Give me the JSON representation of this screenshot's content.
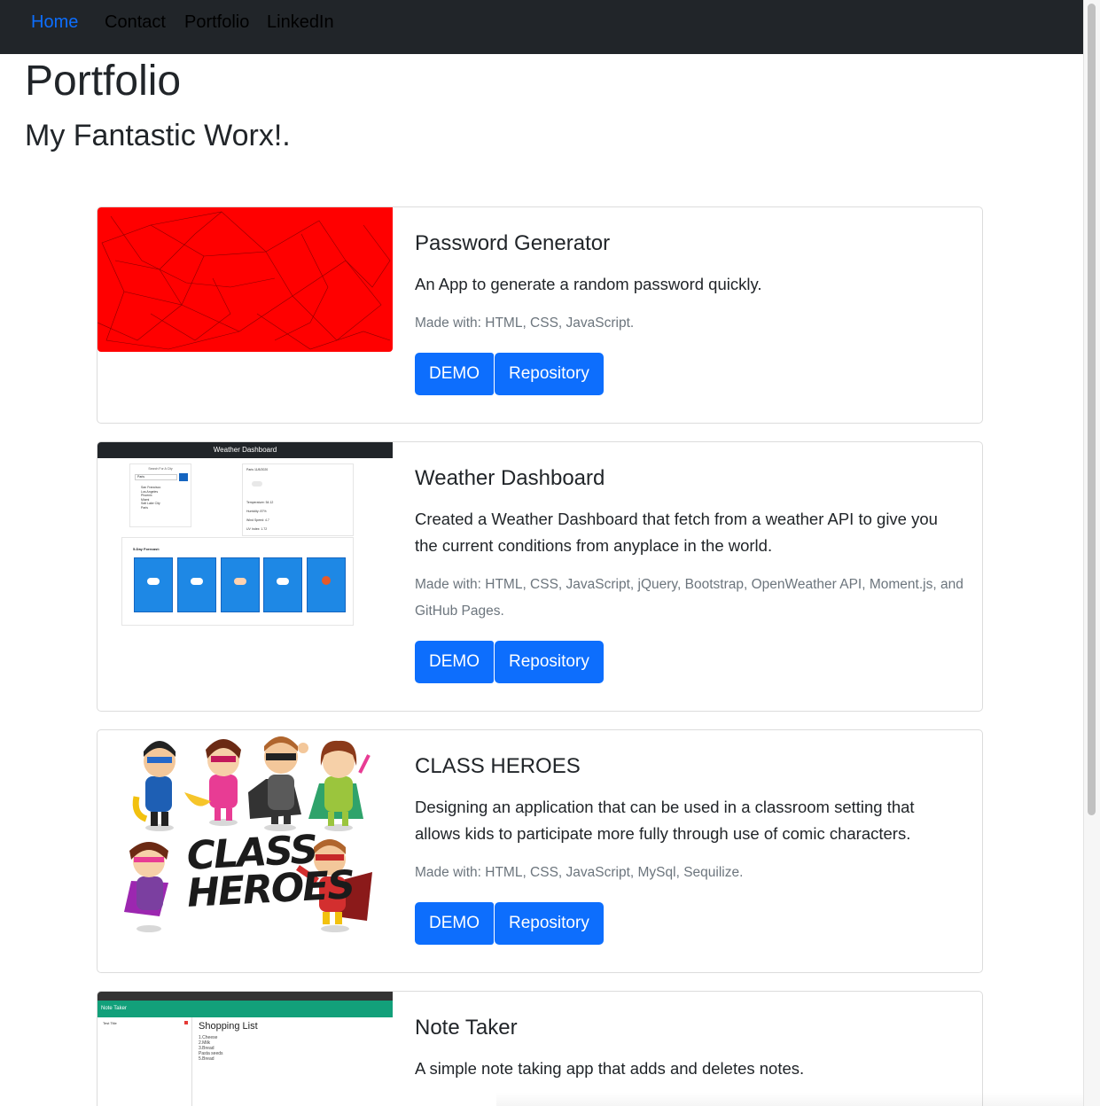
{
  "nav": {
    "items": [
      {
        "label": "Home",
        "active": true
      },
      {
        "label": "Contact",
        "active": false
      },
      {
        "label": "Portfolio",
        "active": false
      },
      {
        "label": "LinkedIn",
        "active": false
      }
    ]
  },
  "header": {
    "title": "Portfolio",
    "subtitle": "My Fantastic Worx!."
  },
  "projects": [
    {
      "title": "Password Generator",
      "description": "An App to generate a random password quickly.",
      "tech": "Made with: HTML, CSS, JavaScript.",
      "demo_label": "DEMO",
      "repo_label": "Repository"
    },
    {
      "title": "Weather Dashboard",
      "description": "Created a Weather Dashboard that fetch from a weather API to give you the current conditions from anyplace in the world.",
      "tech": "Made with: HTML, CSS, JavaScript, jQuery, Bootstrap, OpenWeather API, Moment.js, and GitHub Pages.",
      "demo_label": "DEMO",
      "repo_label": "Repository",
      "thumb": {
        "heading": "Weather Dashboard",
        "search_label": "Search For A City",
        "search_value": "Paris",
        "cities": [
          "San Francisco",
          "Los Angeles",
          "Phoenix",
          "Miami",
          "Salt Lake City",
          "Paris"
        ],
        "current_title": "Paris 11/8/2020",
        "current_lines": [
          "Temperature: 54.12",
          "Humidity: 87%",
          "Wind Speed: 4.7",
          "UV Index: 1.72"
        ],
        "forecast_title": "5-Day Forecast:"
      }
    },
    {
      "title": "CLASS HEROES",
      "description": "Designing an application that can be used in a classroom setting that allows kids to participate more fully through use of comic characters.",
      "tech": "Made with: HTML, CSS, JavaScript, MySql, Sequilize.",
      "demo_label": "DEMO",
      "repo_label": "Repository",
      "logo_text": "CLASS HEROES"
    },
    {
      "title": "Note Taker",
      "description": "A simple note taking app that adds and deletes notes.",
      "thumb": {
        "app_title": "Note Taker",
        "note_item": "Test Title",
        "note_title": "Shopping List",
        "note_lines": [
          "1.Cheese",
          "2.Milk",
          "3.Bread",
          "Pasta seeds",
          "5.Bread"
        ]
      }
    }
  ],
  "colors": {
    "navbar_bg": "#212529",
    "accent": "#0d6efd",
    "password_thumb": "#ff0000",
    "forecast_card": "#1e88e5",
    "note_bar": "#12a07a"
  }
}
